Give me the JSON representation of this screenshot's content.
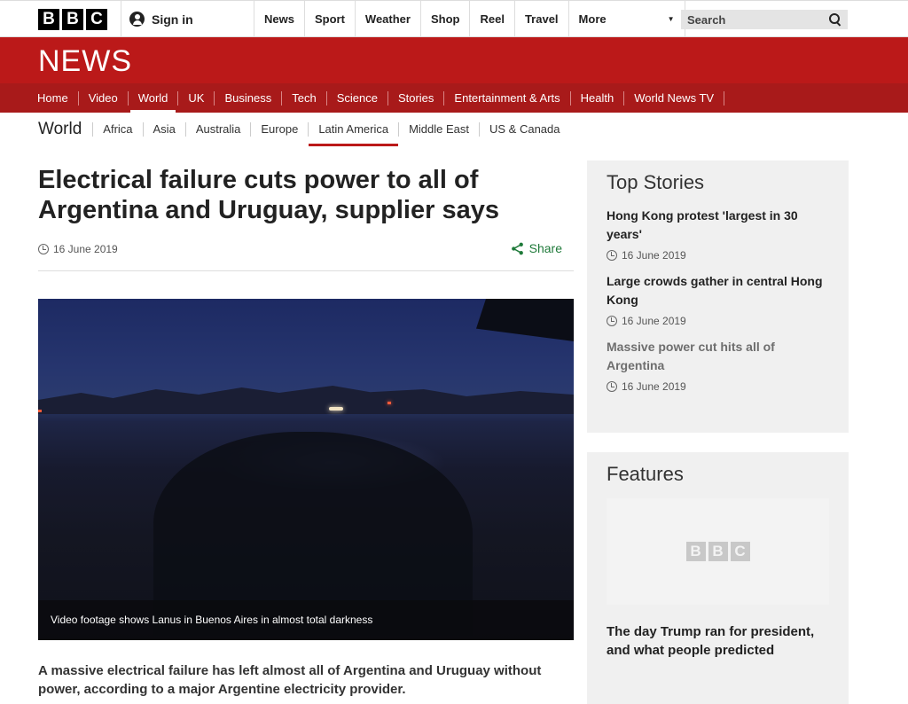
{
  "masthead": {
    "logo_letters": [
      "B",
      "B",
      "C"
    ],
    "sign_in": "Sign in",
    "nav": [
      "News",
      "Sport",
      "Weather",
      "Shop",
      "Reel",
      "Travel"
    ],
    "more": "More",
    "search_placeholder": "Search"
  },
  "banner": {
    "title": "NEWS"
  },
  "main_nav": [
    "Home",
    "Video",
    "World",
    "UK",
    "Business",
    "Tech",
    "Science",
    "Stories",
    "Entertainment & Arts",
    "Health",
    "World News TV"
  ],
  "main_nav_active": "World",
  "sub_nav": {
    "section": "World",
    "items": [
      "Africa",
      "Asia",
      "Australia",
      "Europe",
      "Latin America",
      "Middle East",
      "US & Canada"
    ],
    "active": "Latin America"
  },
  "article": {
    "headline": "Electrical failure cuts power to all of Argentina and Uruguay, supplier says",
    "date": "16 June 2019",
    "share": "Share",
    "video_caption": "Video footage shows Lanus in Buenos Aires in almost total darkness",
    "lead": "A massive electrical failure has left almost all of Argentina and Uruguay without power, according to a major Argentine electricity provider."
  },
  "top_stories": {
    "heading": "Top Stories",
    "items": [
      {
        "title": "Hong Kong protest 'largest in 30 years'",
        "date": "16 June 2019"
      },
      {
        "title": "Large crowds gather in central Hong Kong",
        "date": "16 June 2019"
      },
      {
        "title": "Massive power cut hits all of Argentina",
        "date": "16 June 2019"
      }
    ]
  },
  "features": {
    "heading": "Features",
    "logo_letters": [
      "B",
      "B",
      "C"
    ],
    "title": "The day Trump ran for president, and what people predicted"
  },
  "colors": {
    "brand_red": "#bb1919",
    "nav_red": "#a81a1a",
    "share_green": "#1f7a3a"
  }
}
